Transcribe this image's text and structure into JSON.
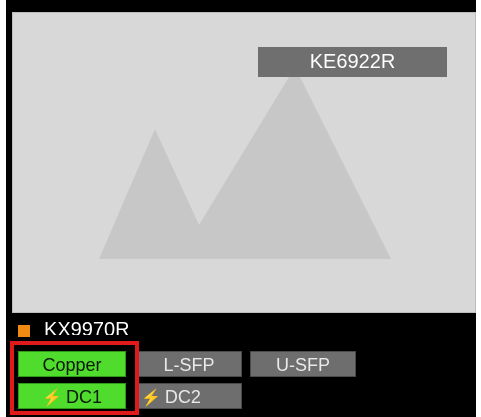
{
  "device": {
    "model": "KE6922R",
    "name": "KX9970R",
    "status_color": "#f08a12"
  },
  "ports": {
    "row1": [
      {
        "label": "Copper",
        "active": true
      },
      {
        "label": "L-SFP",
        "active": false
      },
      {
        "label": "U-SFP",
        "active": false
      }
    ],
    "row2": [
      {
        "label": "DC1",
        "icon": "bolt-icon",
        "active": true
      },
      {
        "label": "DC2",
        "icon": "bolt-icon",
        "active": false
      }
    ]
  },
  "colors": {
    "active_green": "#4fdc2c",
    "inactive_gray": "#6e6e6e",
    "highlight_red": "#e01a1a"
  }
}
